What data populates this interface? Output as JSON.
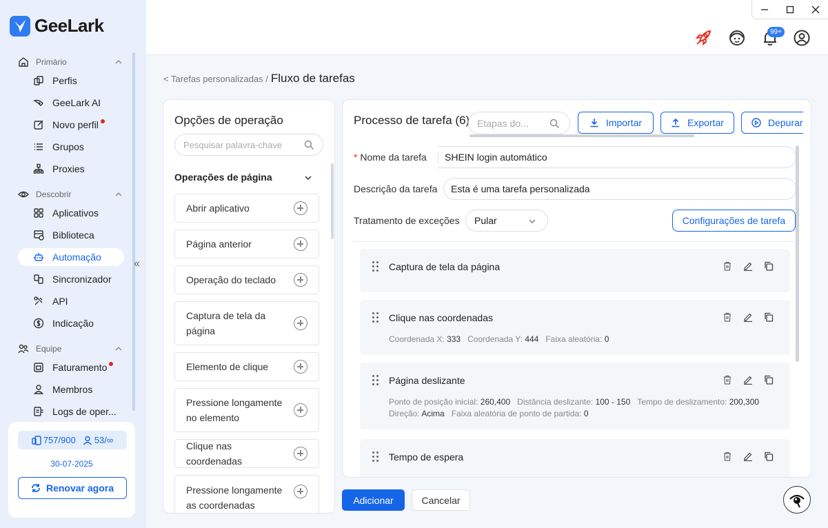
{
  "app": {
    "name": "GeeLark"
  },
  "sidebar": {
    "sections": [
      {
        "label": "Primário",
        "icon": "home-icon",
        "items": [
          {
            "label": "Perfis",
            "icon": "profiles-icon",
            "dot": false
          },
          {
            "label": "GeeLark AI",
            "icon": "ai-icon",
            "dot": false
          },
          {
            "label": "Novo perfil",
            "icon": "edit-icon",
            "dot": true
          },
          {
            "label": "Grupos",
            "icon": "list-icon",
            "dot": false
          },
          {
            "label": "Proxies",
            "icon": "network-icon",
            "dot": false
          }
        ]
      },
      {
        "label": "Descobrir",
        "icon": "eye-icon",
        "items": [
          {
            "label": "Aplicativos",
            "icon": "apps-icon",
            "dot": false
          },
          {
            "label": "Biblioteca",
            "icon": "library-icon",
            "dot": false
          },
          {
            "label": "Automação",
            "icon": "robot-icon",
            "dot": false,
            "active": true
          },
          {
            "label": "Sincronizador",
            "icon": "sync-icon",
            "dot": false
          },
          {
            "label": "API",
            "icon": "api-icon",
            "dot": false
          },
          {
            "label": "Indicação",
            "icon": "dollar-icon",
            "dot": false
          }
        ]
      },
      {
        "label": "Equipe",
        "icon": "team-icon",
        "items": [
          {
            "label": "Faturamento",
            "icon": "billing-icon",
            "dot": true
          },
          {
            "label": "Membros",
            "icon": "member-icon",
            "dot": false
          },
          {
            "label": "Logs de oper...",
            "icon": "logs-icon",
            "dot": false
          }
        ]
      }
    ],
    "quota": {
      "profiles": "757/900",
      "members": "53/∞",
      "date": "30-07-2025",
      "renew_label": "Renovar agora"
    }
  },
  "topbar": {
    "notification_badge": "99+"
  },
  "breadcrumb": {
    "parent": "< Tarefas personalizadas /",
    "current": "Fluxo de tarefas"
  },
  "ops_panel": {
    "title": "Opções de operação",
    "search_placeholder": "Pesquisar palavra-chave",
    "group_label": "Operações de página",
    "items": [
      "Abrir aplicativo",
      "Página anterior",
      "Operação do teclado",
      "Captura de tela da página",
      "Elemento de clique",
      "Pressione longamente no elemento",
      "Clique nas coordenadas",
      "Pressione longamente as coordenadas"
    ]
  },
  "process": {
    "title": "Processo de tarefa (6)",
    "steps_search_placeholder": "Etapas do...",
    "import_label": "Importar",
    "export_label": "Exportar",
    "debug_label": "Depurar",
    "name_label": "Nome da tarefa",
    "name_value": "SHEIN login automático",
    "desc_label": "Descrição da tarefa",
    "desc_value": "Esta é uma tarefa personalizada",
    "exc_label": "Tratamento de exceções",
    "exc_value": "Pular",
    "config_label": "Configurações de tarefa",
    "steps": [
      {
        "title": "Captura de tela da página",
        "meta": []
      },
      {
        "title": "Clique nas coordenadas",
        "meta": [
          [
            {
              "k": "Coordenada X:",
              "v": "333"
            },
            {
              "k": "Coordenada Y:",
              "v": "444"
            },
            {
              "k": "Faixa aleatória:",
              "v": "0"
            }
          ]
        ]
      },
      {
        "title": "Página deslizante",
        "meta": [
          [
            {
              "k": "Ponto de posição inicial:",
              "v": "260,400"
            },
            {
              "k": "Distância deslizante:",
              "v": "100 - 150"
            },
            {
              "k": "Tempo de deslizamento:",
              "v": "200,300"
            }
          ],
          [
            {
              "k": "Direção:",
              "v": "Acima"
            },
            {
              "k": "Faixa aleatória de ponto de partida:",
              "v": "0"
            }
          ]
        ]
      },
      {
        "title": "Tempo de espera",
        "meta": []
      }
    ]
  },
  "footer": {
    "add_label": "Adicionar",
    "cancel_label": "Cancelar"
  }
}
